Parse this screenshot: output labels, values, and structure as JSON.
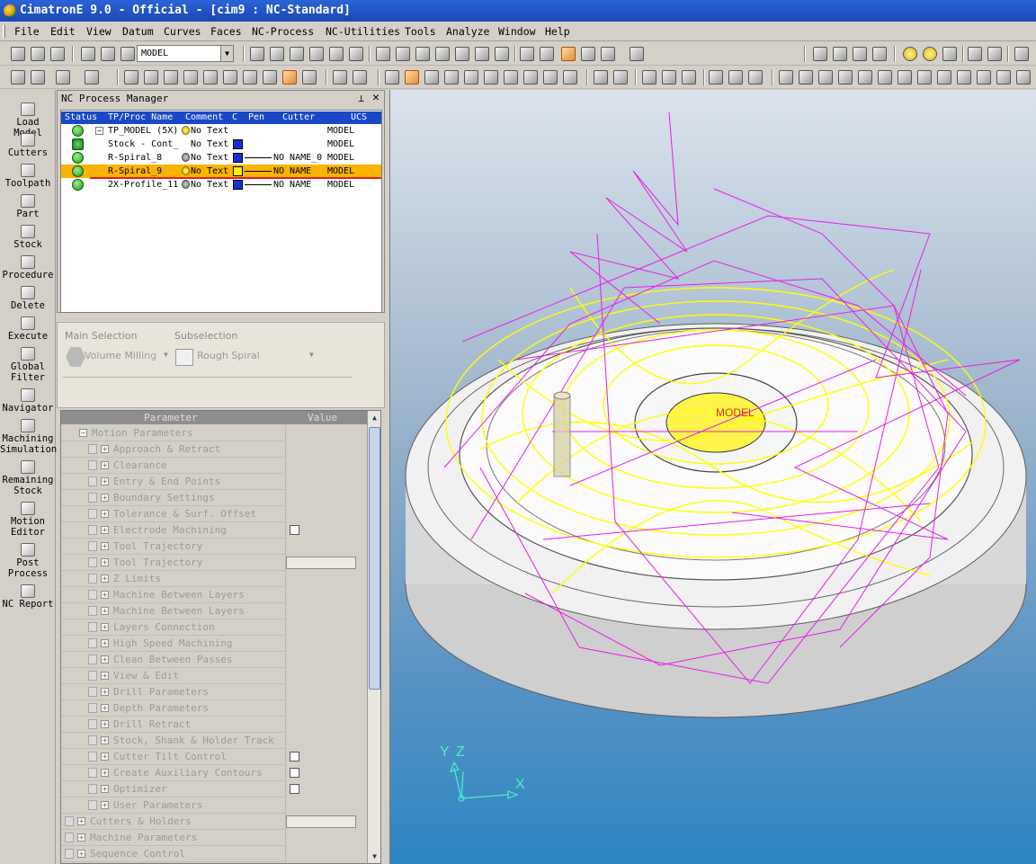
{
  "window": {
    "title": "CimatronE 9.0 - Official - [cim9 : NC-Standard]"
  },
  "menu": [
    "File",
    "Edit",
    "View",
    "Datum",
    "Curves",
    "Faces",
    "NC-Process",
    "NC-Utilities",
    "Tools",
    "Analyze",
    "Window",
    "Help"
  ],
  "toolbar": {
    "model_combo": "MODEL"
  },
  "left_toolbar": [
    {
      "label": "Load Model",
      "icon": "load-model-icon"
    },
    {
      "label": "Cutters",
      "icon": "cutters-icon"
    },
    {
      "label": "Toolpath",
      "icon": "toolpath-icon"
    },
    {
      "label": "Part",
      "icon": "part-icon"
    },
    {
      "label": "Stock",
      "icon": "stock-icon"
    },
    {
      "label": "Procedure",
      "icon": "procedure-icon"
    },
    {
      "label": "Delete",
      "icon": "delete-icon"
    },
    {
      "label": "Execute",
      "icon": "execute-icon"
    },
    {
      "label": "Global Filter",
      "icon": "global-filter-icon"
    },
    {
      "label": "Navigator",
      "icon": "navigator-icon"
    },
    {
      "label": "Machining Simulation",
      "icon": "machining-simulation-icon"
    },
    {
      "label": "Remaining Stock",
      "icon": "remaining-stock-icon"
    },
    {
      "label": "Motion Editor",
      "icon": "motion-editor-icon"
    },
    {
      "label": "Post Process",
      "icon": "post-process-icon"
    },
    {
      "label": "NC Report",
      "icon": "nc-report-icon"
    }
  ],
  "nc_process_manager": {
    "title": "NC Process Manager",
    "columns": [
      "Status",
      "TP/Proc Name",
      "Comment",
      "C",
      "Pen",
      "Cutter",
      "UCS"
    ],
    "rows": [
      {
        "name": "TP_MODEL (5X)",
        "comment": "No Text",
        "cutter": "",
        "ucs": "MODEL",
        "collapse": "−"
      },
      {
        "name": "Stock - Cont_",
        "comment": "No Text",
        "cutter": "",
        "ucs": "MODEL"
      },
      {
        "name": "R-Spiral_8",
        "comment": "No Text",
        "cutter": "NO NAME_0",
        "ucs": "MODEL"
      },
      {
        "name": "R-Spiral_9",
        "comment": "No Text",
        "cutter": "NO NAME",
        "ucs": "MODEL"
      },
      {
        "name": "2X-Profile_11",
        "comment": "No Text",
        "cutter": "NO NAME",
        "ucs": "MODEL"
      }
    ]
  },
  "selection": {
    "main_label": "Main Selection",
    "main_value": "Volume Milling",
    "sub_label": "Subselection",
    "sub_value": "Rough Spiral"
  },
  "params": {
    "header_param": "Parameter",
    "header_value": "Value",
    "rows": [
      {
        "label": "Motion Parameters",
        "level": 1,
        "sign": "−"
      },
      {
        "label": "Approach & Retract",
        "level": 2,
        "sign": "+"
      },
      {
        "label": "Clearance",
        "level": 2,
        "sign": "+"
      },
      {
        "label": "Entry & End Points",
        "level": 2,
        "sign": "+"
      },
      {
        "label": "Boundary Settings",
        "level": 2,
        "sign": "+"
      },
      {
        "label": "Tolerance & Surf. Offset",
        "level": 2,
        "sign": "+"
      },
      {
        "label": "Electrode Machining",
        "level": 2,
        "sign": "+",
        "value": "checkbox"
      },
      {
        "label": "Tool Trajectory",
        "level": 2,
        "sign": "+"
      },
      {
        "label": "Tool Trajectory",
        "level": 2,
        "sign": "+",
        "value": "button"
      },
      {
        "label": "Z Limits",
        "level": 2,
        "sign": "+"
      },
      {
        "label": "Machine Between Layers",
        "level": 2,
        "sign": "+"
      },
      {
        "label": "Machine Between Layers",
        "level": 2,
        "sign": "+"
      },
      {
        "label": "Layers Connection",
        "level": 2,
        "sign": "+"
      },
      {
        "label": "High Speed Machining",
        "level": 2,
        "sign": "+"
      },
      {
        "label": "Clean Between Passes",
        "level": 2,
        "sign": "+"
      },
      {
        "label": "View & Edit",
        "level": 2,
        "sign": "+"
      },
      {
        "label": "Drill Parameters",
        "level": 2,
        "sign": "+"
      },
      {
        "label": "Depth Parameters",
        "level": 2,
        "sign": "+"
      },
      {
        "label": "Drill Retract",
        "level": 2,
        "sign": "+"
      },
      {
        "label": "Stock, Shank & Holder Track",
        "level": 2,
        "sign": "+"
      },
      {
        "label": "Cutter Tilt Control",
        "level": 2,
        "sign": "+",
        "value": "checkbox"
      },
      {
        "label": "Create Auxiliary Contours",
        "level": 2,
        "sign": "+",
        "value": "checkbox"
      },
      {
        "label": "Optimizer",
        "level": 2,
        "sign": "+",
        "value": "checkbox"
      },
      {
        "label": "User Parameters",
        "level": 2,
        "sign": "+"
      },
      {
        "label": "Cutters & Holders",
        "level": 0,
        "sign": "+",
        "value": "button"
      },
      {
        "label": "Machine Parameters",
        "level": 0,
        "sign": "+"
      },
      {
        "label": "Sequence Control",
        "level": 0,
        "sign": "+"
      }
    ]
  },
  "viewport": {
    "ucs_label": "MODEL",
    "axis_x": "X",
    "axis_y": "Y",
    "axis_z": "Z",
    "colors": {
      "toolpath_magenta": "#e81ce8",
      "toolpath_yellow": "#ffff00",
      "part": "#f2f2f2",
      "background_top": "#dbe3ec",
      "background_bottom": "#2d86c4"
    }
  }
}
